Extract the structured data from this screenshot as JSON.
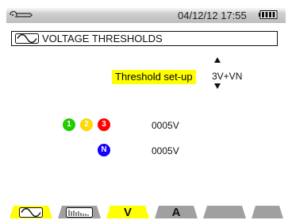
{
  "status": {
    "datetime": "04/12/12 17:55",
    "icons": [
      "wrench-icon",
      "battery-icon"
    ]
  },
  "title": {
    "icon": "waveform-icon",
    "text": "VOLTAGE THRESHOLDS"
  },
  "setup": {
    "label": "Threshold set-up",
    "value": "3V+VN"
  },
  "phases": {
    "l1": "1",
    "l2": "2",
    "l3": "3",
    "l1_color": "#22cc00",
    "l2_color": "#ffd800",
    "l3_color": "#ff0000",
    "threshold": "0005V"
  },
  "neutral": {
    "label": "N",
    "color": "#1100ff",
    "threshold": "0005V"
  },
  "tabs": [
    {
      "icon": "waveform-icon",
      "selected": true
    },
    {
      "icon": "harmonics-icon",
      "selected": false
    },
    {
      "label": "V",
      "selected": true
    },
    {
      "label": "A",
      "selected": false
    },
    {
      "label": "",
      "selected": false
    },
    {
      "label": "",
      "selected": false
    }
  ],
  "colors": {
    "highlight": "#ffff00",
    "tab_inactive": "#a0a0a0"
  }
}
